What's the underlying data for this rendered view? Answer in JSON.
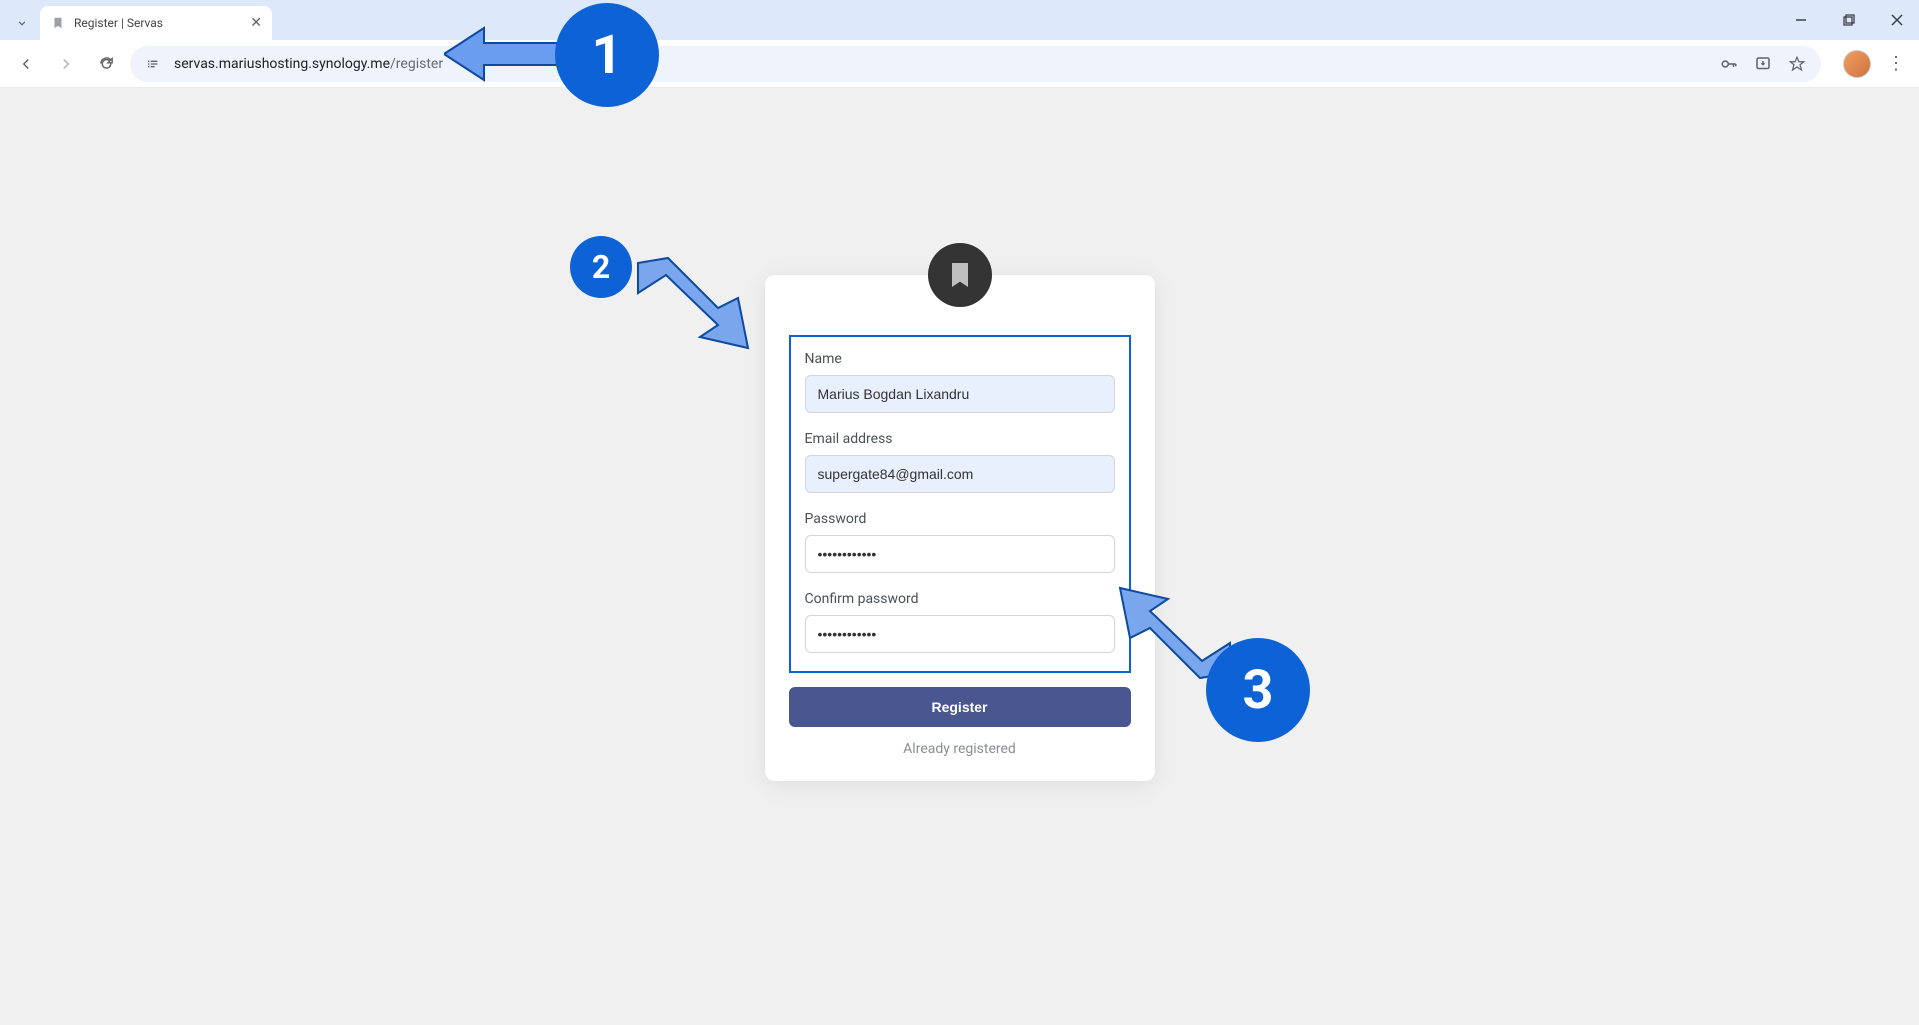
{
  "browser": {
    "tab_title": "Register | Servas",
    "url_domain": "servas.mariushosting.synology.me",
    "url_path": "/register"
  },
  "form": {
    "name_label": "Name",
    "name_value": "Marius Bogdan Lixandru",
    "email_label": "Email address",
    "email_value": "supergate84@gmail.com",
    "password_label": "Password",
    "password_value": "••••••••••••",
    "confirm_label": "Confirm password",
    "confirm_value": "••••••••••••",
    "register_button": "Register",
    "already_link": "Already registered"
  },
  "markers": {
    "one": "1",
    "two": "2",
    "three": "3"
  }
}
